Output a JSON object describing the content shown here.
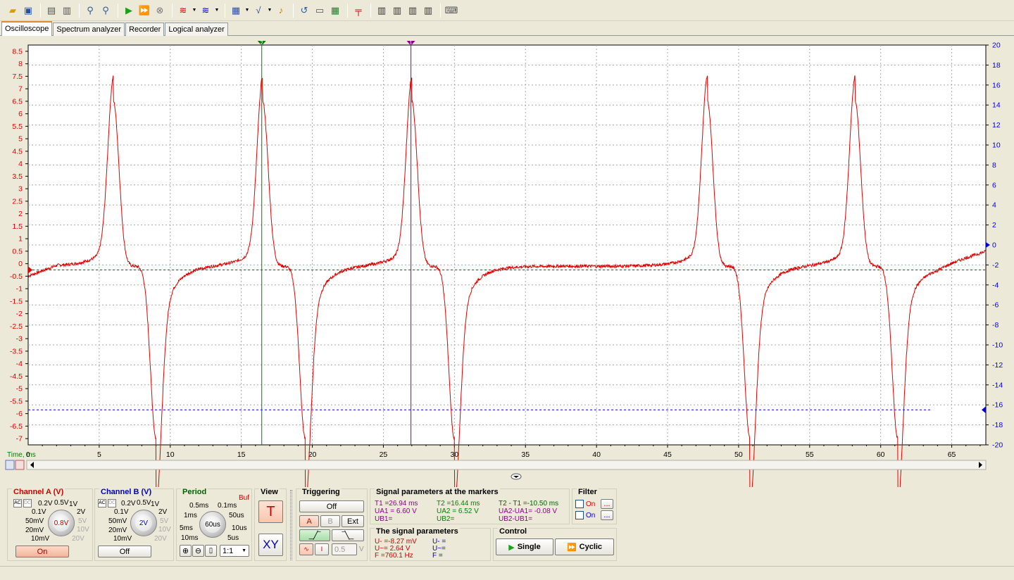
{
  "colors": {
    "channel_a": "#e00000",
    "channel_b": "#0000dd",
    "marker1": "#8b008b",
    "marker2": "#008000"
  },
  "toolbar": {
    "icons": [
      "open-icon",
      "save-icon",
      "print-preview-icon",
      "print-icon",
      "zoom-icon",
      "zoom-settings-icon",
      "run-icon",
      "run-fast-icon",
      "stop-icon",
      "signal-a-icon",
      "signal-b-icon",
      "calculator-icon",
      "sqrt-icon",
      "sound-icon",
      "refresh-icon",
      "export-icon",
      "table-icon",
      "trigger-icon",
      "channel-config-1-icon",
      "channel-config-2-icon",
      "channel-config-3-icon",
      "channel-config-4-icon",
      "device-icon"
    ]
  },
  "tabs": [
    "Oscilloscope",
    "Spectrum analyzer",
    "Recorder",
    "Logical analyzer"
  ],
  "scope": {
    "left_ticks": [
      "8.5",
      "8",
      "7.5",
      "7",
      "6.5",
      "6",
      "5.5",
      "5",
      "4.5",
      "4",
      "3.5",
      "3",
      "2.5",
      "2",
      "1.5",
      "1",
      "0.5",
      "0",
      "-0.5",
      "-1",
      "-1.5",
      "-2",
      "-2.5",
      "-3",
      "-3.5",
      "-4",
      "-4.5",
      "-5",
      "-5.5",
      "-6",
      "-6.5",
      "-7"
    ],
    "right_ticks": [
      "20",
      "18",
      "16",
      "14",
      "12",
      "10",
      "8",
      "6",
      "4",
      "2",
      "0",
      "-2",
      "-4",
      "-6",
      "-8",
      "-10",
      "-12",
      "-14",
      "-16",
      "-18",
      "-20"
    ],
    "x_ticks": [
      "5",
      "10",
      "15",
      "20",
      "25",
      "30",
      "35",
      "40",
      "45",
      "50",
      "55",
      "60",
      "65"
    ],
    "time_label": "Time, ms",
    "x_zero_label": "0",
    "marker_labels": {
      "m1": "1",
      "m2": "2"
    },
    "marker1_x": 26.94,
    "marker2_x": 16.44,
    "x_max": 67.4,
    "channel_a_level": -0.25,
    "channel_b_level": -16.5
  },
  "channel_a": {
    "title": "Channel A (V)",
    "dial": [
      "0.2V",
      "0.5V",
      "1V",
      "2V",
      "5V",
      "10V",
      "20V",
      "0.1V",
      "50mV",
      "20mV",
      "10mV"
    ],
    "value": "0.8V",
    "ac": "AC",
    "dc": "DC",
    "state": "On"
  },
  "channel_b": {
    "title": "Channel B (V)",
    "dial": [
      "0.2V",
      "0.5V",
      "1V",
      "2V",
      "5V",
      "10V",
      "20V",
      "0.1V",
      "50mV",
      "20mV",
      "10mV"
    ],
    "value": "2V",
    "ac": "AC",
    "dc": "DC",
    "state": "Off"
  },
  "period": {
    "title": "Period",
    "buf": "Buf",
    "dial": [
      "0.5ms",
      "0.1ms",
      "1ms",
      "50us",
      "5ms",
      "10us",
      "10ms",
      "5us"
    ],
    "value": "60us",
    "ratio": "1:1"
  },
  "view": {
    "title": "View",
    "t_button": "T",
    "xy_button": "XY"
  },
  "triggering": {
    "title": "Triggering",
    "mode": "Off",
    "sources": [
      "A",
      "B",
      "Ext"
    ],
    "level": "0.5",
    "unit": "V"
  },
  "markers_params": {
    "title": "Signal parameters at the markers",
    "t1": "T1 =26.94 ms",
    "ua1": "UA1 = 6.60 V",
    "ub1": "UB1=",
    "t2": "T2 =16.44 ms",
    "ua2": "UA2 = 6.52 V",
    "ub2": "UB2=",
    "dt": "T2 - T1 =-10.50 ms",
    "dua": "UA2-UA1= -0.08 V",
    "dub": "UB2-UB1="
  },
  "signal_params": {
    "title": "The signal parameters",
    "u_dc_a": "U- =-8.27 mV",
    "u_ac_a": "U~= 2.64 V",
    "f_a": "F  =760.1 Hz",
    "u_dc_b": "U- =",
    "u_ac_b": "U~=",
    "f_b": "F  ="
  },
  "filter": {
    "title": "Filter",
    "on1": "On",
    "on2": "On",
    "more": "..."
  },
  "control": {
    "title": "Control",
    "single": "Single",
    "cyclic": "Cyclic"
  }
}
